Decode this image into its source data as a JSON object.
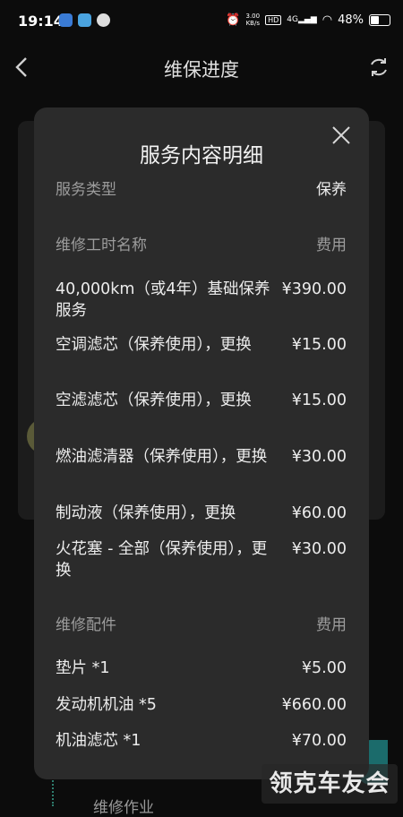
{
  "status_bar": {
    "time": "19:14",
    "speed_top": "3.00",
    "speed_bottom": "KB/s",
    "hd": "HD",
    "network": "4G",
    "battery": "48%",
    "battery_level": 0.48
  },
  "header": {
    "title": "维保进度"
  },
  "background": {
    "bottom_label": "维修作业"
  },
  "modal": {
    "title": "服务内容明细",
    "service_type_label": "服务类型",
    "service_type_value": "保养",
    "labor_header": "维修工时名称",
    "labor_fee_header": "费用",
    "labor_items": [
      {
        "name": "40,000km（或4年）基础保养服务",
        "price": "¥390.00"
      },
      {
        "name": "空调滤芯（保养使用），更换",
        "price": "¥15.00"
      },
      {
        "name": "空滤滤芯（保养使用），更换",
        "price": "¥15.00"
      },
      {
        "name": "燃油滤清器（保养使用），更换",
        "price": "¥30.00"
      },
      {
        "name": "制动液（保养使用），更换",
        "price": "¥60.00"
      },
      {
        "name": "火花塞 - 全部（保养使用），更换",
        "price": "¥30.00"
      }
    ],
    "parts_header": "维修配件",
    "parts_fee_header": "费用",
    "parts_items": [
      {
        "name": "垫片 *1",
        "price": "¥5.00"
      },
      {
        "name": "发动机机油 *5",
        "price": "¥660.00"
      },
      {
        "name": "机油滤芯 *1",
        "price": "¥70.00"
      }
    ]
  },
  "watermark": "领克车友会"
}
